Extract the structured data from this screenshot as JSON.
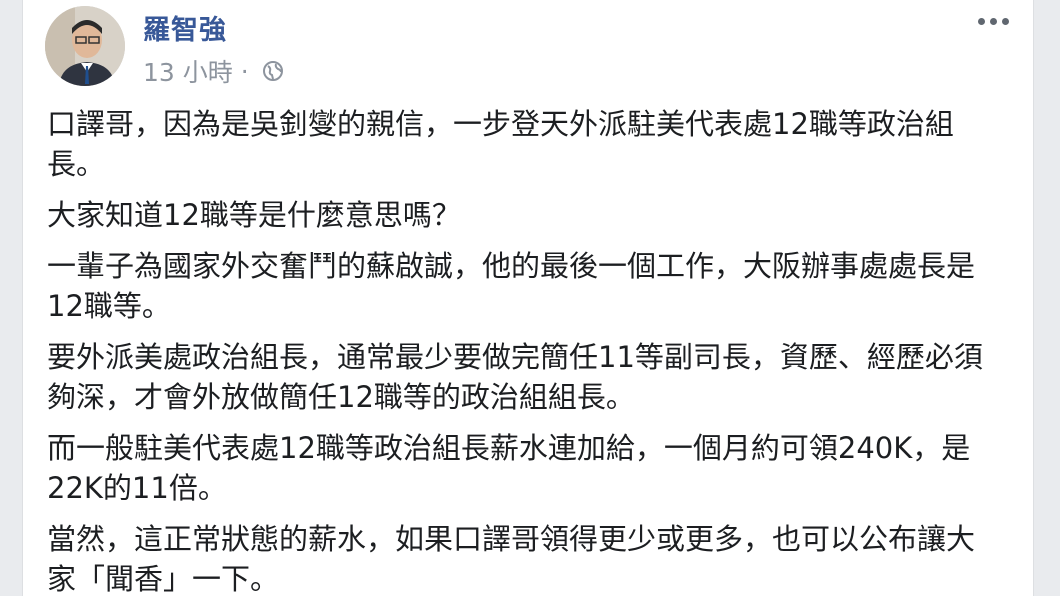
{
  "post": {
    "author": "羅智強",
    "time": "13 小時",
    "separator": "·",
    "privacy_icon": "globe-icon",
    "more_icon": "more-options-icon",
    "paragraphs": [
      "口譯哥，因為是吳釗燮的親信，一步登天外派駐美代表處12職等政治組長。",
      "大家知道12職等是什麼意思嗎？",
      "一輩子為國家外交奮鬥的蘇啟誠，他的最後一個工作，大阪辦事處處長是12職等。",
      "要外派美處政治組長，通常最少要做完簡任11等副司長，資歷、經歷必須夠深，才會外放做簡任12職等的政治組組長。",
      "而一般駐美代表處12職等政治組長薪水連加給，一個月約可領240K，是22K的11倍。",
      "當然，這正常狀態的薪水，如果口譯哥領得更少或更多，也可以公布讓大家「聞香」一下。"
    ]
  },
  "colors": {
    "author": "#385898",
    "meta": "#8d949e",
    "text": "#1c1e21",
    "background": "#e9ebee"
  }
}
